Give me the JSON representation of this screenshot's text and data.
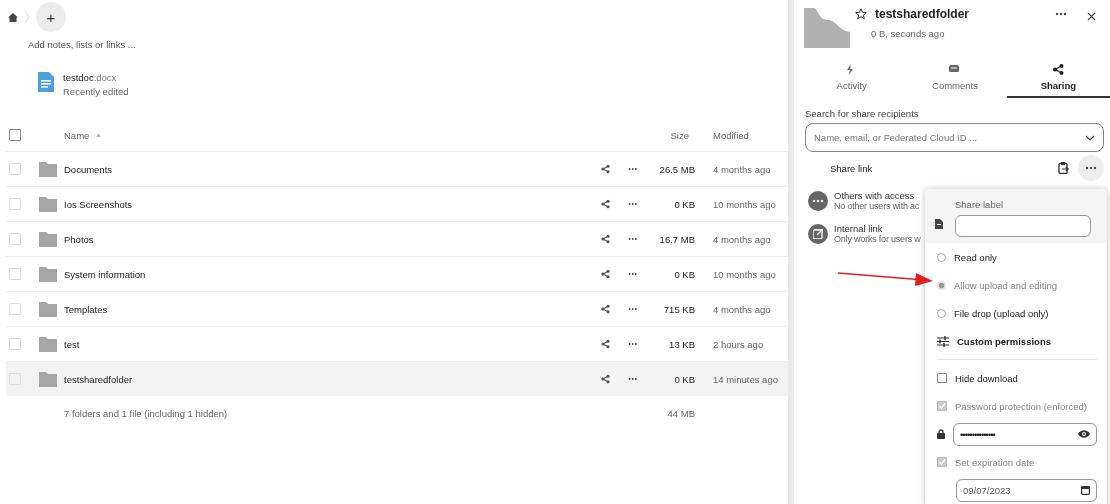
{
  "breadcrumb": {
    "add_button": "+"
  },
  "notes_placeholder": "Add notes, lists or links ...",
  "recent": {
    "name": "testdoc",
    "extension": ".docx",
    "subtitle": "Recently edited"
  },
  "table": {
    "select_all_checked": false,
    "columns": [
      "Name",
      "Size",
      "Modified"
    ],
    "rows": [
      {
        "name": "Documents",
        "size": "26.5 MB",
        "modified": "4 months ago",
        "selected": false
      },
      {
        "name": "Ios Screenshots",
        "size": "0 KB",
        "modified": "10 months ago",
        "selected": false
      },
      {
        "name": "Photos",
        "size": "16.7 MB",
        "modified": "4 months ago",
        "selected": false
      },
      {
        "name": "System information",
        "size": "0 KB",
        "modified": "10 months ago",
        "selected": false
      },
      {
        "name": "Templates",
        "size": "715 KB",
        "modified": "4 months ago",
        "selected": false
      },
      {
        "name": "test",
        "size": "13 KB",
        "modified": "2 hours ago",
        "selected": false
      },
      {
        "name": "testsharedfolder",
        "size": "0 KB",
        "modified": "14 minutes ago",
        "selected": true
      }
    ],
    "summary": "7 folders and 1 file (including 1 hidden)",
    "total_size": "44 MB"
  },
  "sidebar": {
    "title": "testsharedfolder",
    "subtitle": "0 B, seconds ago",
    "tabs": [
      {
        "label": "Activity",
        "kind": "activity",
        "selected": false
      },
      {
        "label": "Comments",
        "kind": "comments",
        "selected": false
      },
      {
        "label": "Sharing",
        "kind": "sharing",
        "selected": true
      }
    ],
    "search_label": "Search for share recipients",
    "search_placeholder": "Name, email, or Federated Cloud ID ...",
    "share_link": "Share link",
    "entries": [
      {
        "kind": "others",
        "title": "Others with access",
        "subtitle": "No other users with ac"
      },
      {
        "kind": "internal",
        "title": "Internal link",
        "subtitle": "Only works for users w"
      }
    ]
  },
  "menu": {
    "share_label": "Share label",
    "items": [
      {
        "kind": "radio",
        "label": "Read only",
        "selected": false,
        "disabled": false
      },
      {
        "kind": "radio",
        "label": "Allow upload and editing",
        "selected": true,
        "disabled": true
      },
      {
        "kind": "radio",
        "label": "File drop (upload only)",
        "selected": false,
        "disabled": false
      },
      {
        "kind": "action",
        "label": "Custom permissions"
      },
      {
        "kind": "divider"
      },
      {
        "kind": "checkbox",
        "label": "Hide download",
        "checked": false,
        "disabled": false
      },
      {
        "kind": "checkbox",
        "label": "Password protection (enforced)",
        "checked": true,
        "disabled": true
      },
      {
        "kind": "password",
        "value": "•••••••••••••••"
      },
      {
        "kind": "checkbox",
        "label": "Set expiration date",
        "checked": true,
        "disabled": true
      },
      {
        "kind": "date",
        "value": "09/07/2023"
      }
    ]
  }
}
